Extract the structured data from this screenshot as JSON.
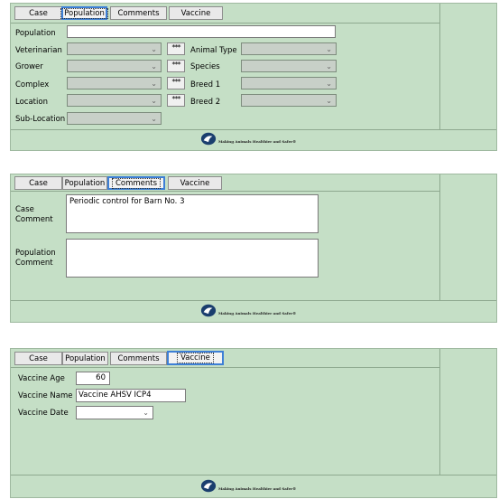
{
  "tabs": {
    "case": "Case",
    "population": "Population",
    "comments": "Comments",
    "vaccine": "Vaccine"
  },
  "population_form": {
    "population_label": "Population",
    "veterinarian_label": "Veterinarian",
    "grower_label": "Grower",
    "complex_label": "Complex",
    "location_label": "Location",
    "sublocation_label": "Sub-Location",
    "animal_type_label": "Animal Type",
    "species_label": "Species",
    "breed1_label": "Breed 1",
    "breed2_label": "Breed 2",
    "dots_label": "***"
  },
  "comments_form": {
    "case_comment_label": "Case Comment",
    "case_comment_value": "Periodic control for Barn No. 3",
    "population_comment_label": "Population Comment",
    "population_comment_value": ""
  },
  "vaccine_form": {
    "vaccine_age_label": "Vaccine Age",
    "vaccine_age_value": "60",
    "vaccine_name_label": "Vaccine Name",
    "vaccine_name_value": "Vaccine AHSV ICP4",
    "vaccine_date_label": "Vaccine Date",
    "vaccine_date_value": ""
  },
  "footer": {
    "tagline": "Making Animals Healthier and Safer®"
  },
  "icons": {
    "chevron": "chevron-down-icon",
    "logo": "logo-mark-icon"
  }
}
